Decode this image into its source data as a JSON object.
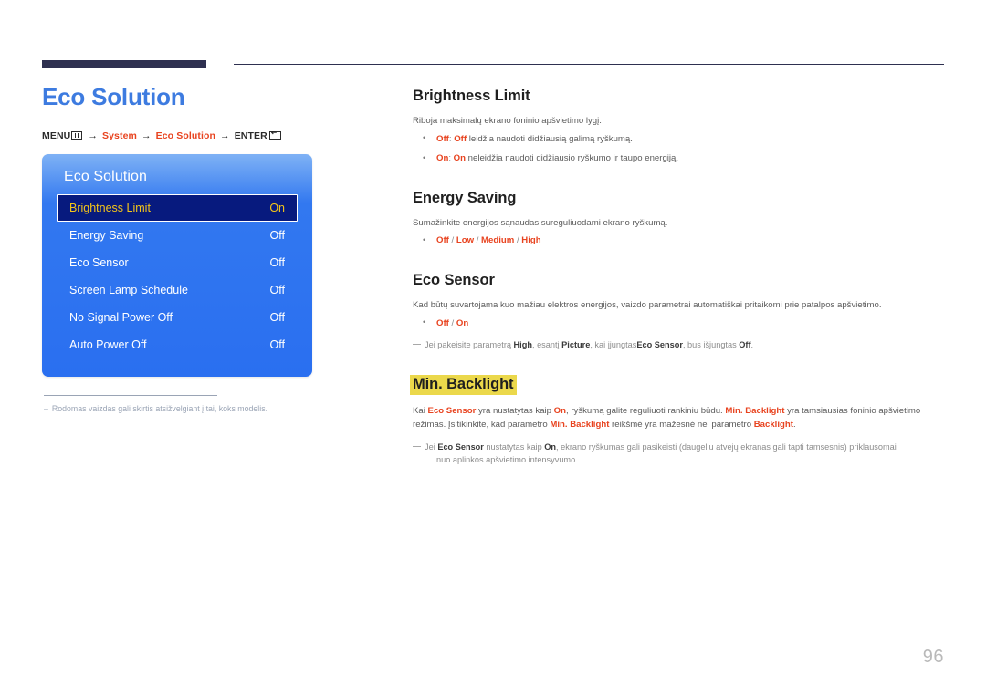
{
  "page": {
    "number": "96",
    "title": "Eco Solution"
  },
  "breadcrumb": {
    "menu_label": "MENU",
    "menu_icon": "menu-grid-icon",
    "arrow": "→",
    "step1": "System",
    "step2": "Eco Solution",
    "enter_label": "ENTER",
    "enter_icon": "enter-key-icon"
  },
  "osd": {
    "title": "Eco Solution",
    "rows": [
      {
        "label": "Brightness Limit",
        "value": "On",
        "selected": true
      },
      {
        "label": "Energy Saving",
        "value": "Off",
        "selected": false
      },
      {
        "label": "Eco Sensor",
        "value": "Off",
        "selected": false
      },
      {
        "label": "Screen Lamp Schedule",
        "value": "Off",
        "selected": false
      },
      {
        "label": "No Signal Power Off",
        "value": "Off",
        "selected": false
      },
      {
        "label": "Auto Power Off",
        "value": "Off",
        "selected": false
      }
    ],
    "footnote_dash": "–",
    "footnote": "Rodomas vaizdas gali skirtis atsižvelgiant į tai, koks modelis."
  },
  "sections": {
    "brightness_limit": {
      "heading": "Brightness Limit",
      "intro": "Riboja maksimalų ekrano foninio apšvietimo lygį.",
      "bullet_off_key": "Off",
      "bullet_off_key2": "Off",
      "bullet_off_rest": " leidžia naudoti didžiausią galimą ryškumą.",
      "bullet_on_key": "On",
      "bullet_on_key2": "On",
      "bullet_on_rest": " neleidžia naudoti didžiausio ryškumo ir taupo energiją."
    },
    "energy_saving": {
      "heading": "Energy Saving",
      "intro": "Sumažinkite energijos sąnaudas sureguliuodami ekrano ryškumą.",
      "options": [
        "Off",
        "Low",
        "Medium",
        "High"
      ],
      "option_sep": " / "
    },
    "eco_sensor": {
      "heading": "Eco Sensor",
      "intro": "Kad būtų suvartojama kuo mažiau elektros energijos, vaizdo parametrai automatiškai pritaikomi prie patalpos apšvietimo.",
      "options": [
        "Off",
        "On"
      ],
      "option_sep": " / ",
      "note_a1": "Jei pakeisite parametrą ",
      "note_a_k1": "High",
      "note_a2": ", esantį ",
      "note_a_k2": "Picture",
      "note_a3": ", kai įjungtas",
      "note_a_k3": "Eco Sensor",
      "note_a4": ", bus išjungtas ",
      "note_a_k4": "Off",
      "note_a5": "."
    },
    "min_backlight": {
      "heading": "Min. Backlight",
      "p1_a": "Kai ",
      "p1_k1": "Eco Sensor",
      "p1_b": " yra nustatytas kaip ",
      "p1_k2": "On",
      "p1_c": ", ryškumą galite reguliuoti rankiniu būdu. ",
      "p1_k3": "Min. Backlight",
      "p1_d": " yra tamsiausias foninio apšvietimo režimas. Įsitikinkite, kad parametro ",
      "p1_k4": "Min. Backlight",
      "p1_e": " reikšmė yra mažesnė nei parametro ",
      "p1_k5": "Backlight",
      "p1_f": ".",
      "note_a1": "Jei ",
      "note_a_k1": "Eco Sensor",
      "note_a2": " nustatytas kaip ",
      "note_a_k2": "On",
      "note_a3": ", ekrano ryškumas gali pasikeisti (daugeliu atvejų ekranas gali tapti tamsesnis) priklausomai",
      "note_a4": "nuo aplinkos apšvietimo intensyvumo."
    }
  },
  "colors": {
    "accent_blue": "#3d7be0",
    "accent_red": "#e8431f",
    "osd_blue": "#2a6ff0",
    "osd_selected_bg": "#071a7e",
    "osd_selected_text": "#f5c518",
    "highlight_yellow": "#ebd84b",
    "rule_navy": "#2e3050"
  }
}
